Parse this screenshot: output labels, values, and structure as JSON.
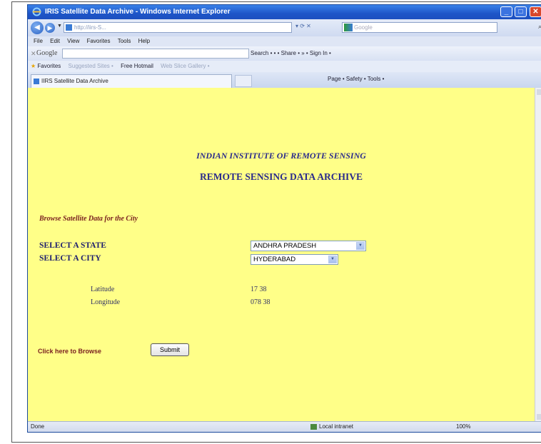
{
  "window": {
    "title": "IRIS Satellite Data Archive - Windows Internet Explorer"
  },
  "address_bar": {
    "url": "http://iirs-S...",
    "search_placeholder": "Google"
  },
  "menu": [
    "File",
    "Edit",
    "View",
    "Favorites",
    "Tools",
    "Help"
  ],
  "google_toolbar": {
    "logo": "Google",
    "tools": "Search • • • Share • » • Sign In •"
  },
  "favorites_bar": {
    "favorites_label": "Favorites",
    "suggested_sites": "Suggested Sites •",
    "free_hotmail": "Free Hotmail",
    "web_slice_gallery": "Web Slice Gallery •"
  },
  "tab": {
    "label": "IIRS Satellite Data Archive",
    "commands": "Page •   Safety •   Tools •"
  },
  "page": {
    "institute_title": "INDIAN INSTITUTE OF REMOTE SENSING",
    "archive_title": "REMOTE SENSING DATA ARCHIVE",
    "browse_caption": "Browse Satellite Data for the City",
    "state_label": "SELECT A STATE",
    "state_value": "ANDHRA PRADESH",
    "city_label": "SELECT A CITY",
    "city_value": "HYDERABAD",
    "latitude_label": "Latitude",
    "latitude_value": "17 38",
    "longitude_label": "Longitude",
    "longitude_value": "078 38",
    "click_caption": "Click here to Browse",
    "submit_label": "Submit"
  },
  "status_bar": {
    "status": "Done",
    "zone": "Local intranet",
    "zoom": "100%"
  },
  "colors": {
    "page_background": "#ffff88",
    "heading_blue": "#2a2a8c",
    "caption_maroon": "#7a2020"
  }
}
